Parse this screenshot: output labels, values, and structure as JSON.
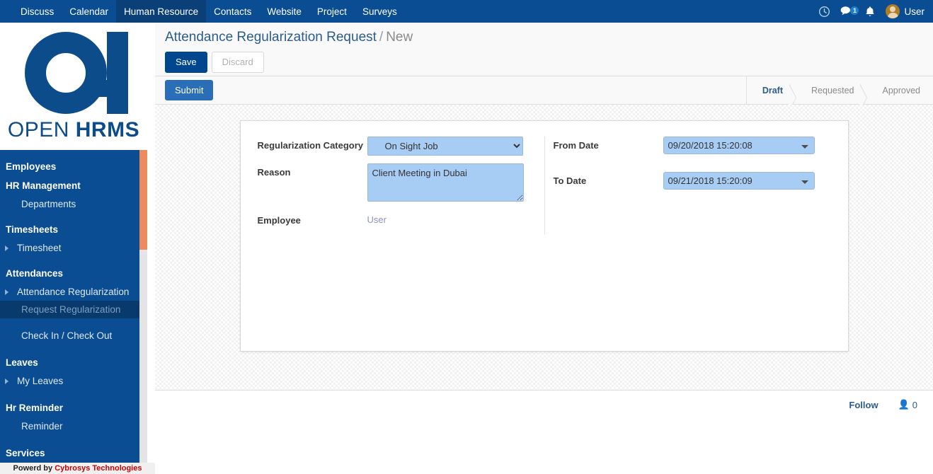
{
  "topbar": {
    "menus": [
      {
        "label": "Discuss",
        "active": false
      },
      {
        "label": "Calendar",
        "active": false
      },
      {
        "label": "Human Resource",
        "active": true
      },
      {
        "label": "Contacts",
        "active": false
      },
      {
        "label": "Website",
        "active": false
      },
      {
        "label": "Project",
        "active": false
      },
      {
        "label": "Surveys",
        "active": false
      }
    ],
    "icons": {
      "clock": "clock-icon",
      "chat": "chat-icon",
      "chat_badge": "1",
      "bell": "bell-icon"
    },
    "user_name": "User",
    "accent": "#0b4d93"
  },
  "sidebar": {
    "logo": {
      "word1": "OPEN",
      "word2": "HRMS",
      "color": "#0c4c8a"
    },
    "items": [
      {
        "label": "Employees",
        "type": "section",
        "active": false,
        "caret": false
      },
      {
        "label": "HR Management",
        "type": "section",
        "active": false,
        "caret": false
      },
      {
        "label": "Departments",
        "type": "item-sub",
        "active": false,
        "caret": false
      },
      {
        "label": "Timesheets",
        "type": "section",
        "active": false,
        "caret": false
      },
      {
        "label": "Timesheet",
        "type": "item",
        "active": false,
        "caret": true
      },
      {
        "label": "Attendances",
        "type": "section",
        "active": false,
        "caret": false
      },
      {
        "label": "Attendance Regularization",
        "type": "item",
        "active": false,
        "caret": true
      },
      {
        "label": "Request Regularization",
        "type": "item-sub",
        "active": true,
        "caret": false
      },
      {
        "label": "Check In / Check Out",
        "type": "item-sub",
        "active": false,
        "caret": false
      },
      {
        "label": "Leaves",
        "type": "section",
        "active": false,
        "caret": false
      },
      {
        "label": "My Leaves",
        "type": "item",
        "active": false,
        "caret": true
      },
      {
        "label": "Hr Reminder",
        "type": "section",
        "active": false,
        "caret": false
      },
      {
        "label": "Reminder",
        "type": "item-sub",
        "active": false,
        "caret": false
      },
      {
        "label": "Services",
        "type": "section",
        "active": false,
        "caret": false
      }
    ],
    "footer_prefix": "Powerd by ",
    "footer_brand": "Cybrosys Technologies",
    "scrollbar_color": "#ed8b5e"
  },
  "control_panel": {
    "breadcrumb_main": "Attendance Regularization Request",
    "breadcrumb_sep": "/",
    "breadcrumb_current": "New",
    "save_label": "Save",
    "discard_label": "Discard"
  },
  "statusbar": {
    "submit_label": "Submit",
    "stages": [
      {
        "label": "Draft",
        "active": true
      },
      {
        "label": "Requested",
        "active": false
      },
      {
        "label": "Approved",
        "active": false
      }
    ]
  },
  "form": {
    "left": {
      "category_label": "Regularization Category",
      "category_value": "On Sight Job",
      "category_options": [
        "On Sight Job"
      ],
      "reason_label": "Reason",
      "reason_value": "Client Meeting in Dubai",
      "employee_label": "Employee",
      "employee_value": "User"
    },
    "right": {
      "from_label": "From Date",
      "from_value": "09/20/2018 15:20:08",
      "to_label": "To Date",
      "to_value": "09/21/2018 15:20:09"
    },
    "input_bg": "#a8cdf5"
  },
  "chatter": {
    "follow_label": "Follow",
    "followers_count": "0"
  }
}
